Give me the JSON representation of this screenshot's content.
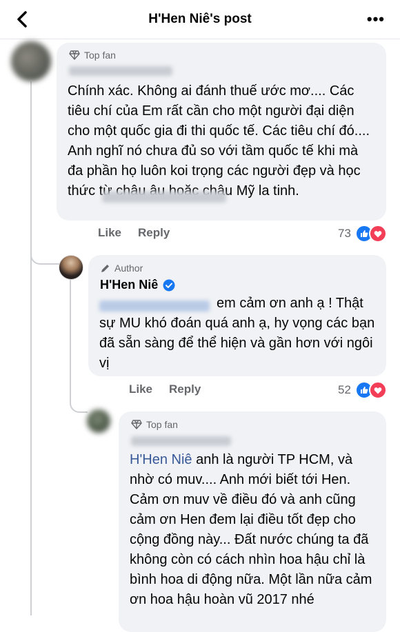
{
  "header": {
    "title": "H'Hen Niê's post",
    "back_icon": "chevron-left-icon",
    "more_label": "•••"
  },
  "comments": [
    {
      "badge": "Top fan",
      "text": "Chính xác. Không ai đánh thuế ước mơ.... Các tiêu chí của Em rất cần cho một người đại diện cho một quốc gia đi thi quốc tế. Các tiêu chí đó.... Anh nghĩ nó chưa đủ so với tầm quốc tế khi mà đa phần họ luôn koi trọng các người đẹp và học thức từ châu âu hoặc châu Mỹ la tinh.",
      "like": "Like",
      "reply": "Reply",
      "reactions": "73"
    },
    {
      "badge": "Author",
      "author": "H'Hen Niê",
      "text": "em cảm ơn anh ạ ! Thật sự MU khó đoán quá anh ạ, hy vọng các bạn đã sẵn sàng để thể hiện và gần hơn với ngôi vị",
      "like": "Like",
      "reply": "Reply",
      "reactions": "52"
    },
    {
      "badge": "Top fan",
      "mention": "H'Hen Niê",
      "text": "anh là người TP HCM, và nhờ có muv.... Anh mới biết tới Hen. Cảm ơn muv về điều đó và anh cũng cảm ơn Hen đem lại điều tốt đẹp cho cộng đồng này... Đất nước chúng ta đã không còn có cách nhìn hoa hậu chỉ là bình hoa di động nữa. Một lần nữa cảm ơn hoa hậu hoàn vũ 2017 nhé"
    }
  ],
  "colors": {
    "like_blue": "#1877f2",
    "love_red": "#f33e58",
    "bubble": "#f0f2f5",
    "verified": "#1877f2"
  }
}
